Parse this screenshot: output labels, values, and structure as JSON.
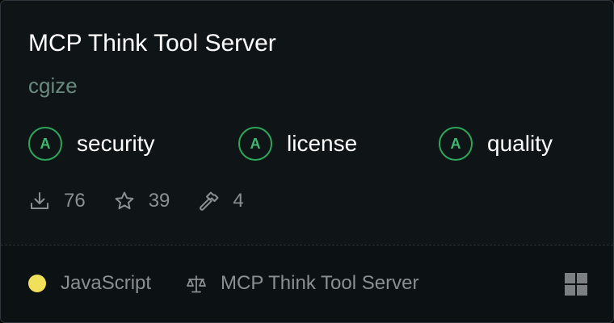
{
  "card": {
    "title": "MCP Think Tool Server",
    "author": "cgize"
  },
  "grades": [
    {
      "letter": "A",
      "label": "security"
    },
    {
      "letter": "A",
      "label": "license"
    },
    {
      "letter": "A",
      "label": "quality"
    }
  ],
  "stats": {
    "downloads": "76",
    "stars": "39",
    "tools": "4"
  },
  "footer": {
    "language": "JavaScript",
    "language_color": "#f1e05a",
    "license": "MCP Think Tool Server"
  },
  "icons": {
    "downloads": "download-icon",
    "stars": "star-icon",
    "tools": "hammer-icon",
    "license": "scale-icon",
    "grid": "grid-icon"
  },
  "colors": {
    "grade_ring": "#2ea65a",
    "background": "#0f1517"
  }
}
